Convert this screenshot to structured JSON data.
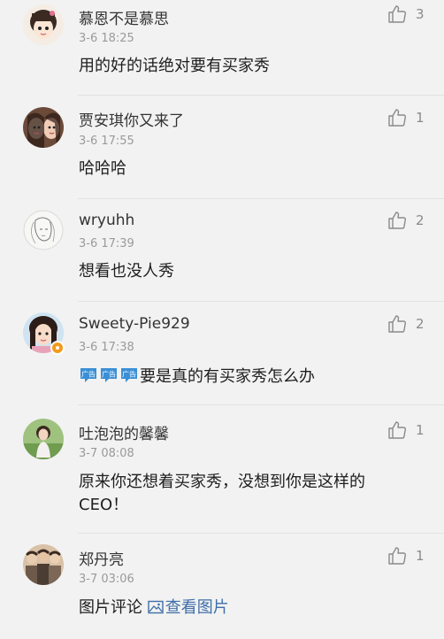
{
  "comments": [
    {
      "name": "慕恩不是慕思",
      "time": "3-6 18:25",
      "text": "用的好的话绝对要有买家秀",
      "likes": "3"
    },
    {
      "name": "贾安琪你又来了",
      "time": "3-6 17:55",
      "text": "哈哈哈",
      "likes": "1"
    },
    {
      "name": "wryuhh",
      "time": "3-6 17:39",
      "text": "想看也没人秀",
      "likes": "2"
    },
    {
      "name": "Sweety-Pie929",
      "time": "3-6 17:38",
      "text": "要是真的有买家秀怎么办",
      "likes": "2",
      "emoji_label": "广告"
    },
    {
      "name": "吐泡泡的馨馨",
      "time": "3-7 08:08",
      "text_line1": "原来你还想着买家秀，没想到你是这样的",
      "text_line2": "CEO！",
      "likes": "1"
    },
    {
      "name": "郑丹亮",
      "time": "3-7 03:06",
      "text": "图片评论",
      "link": "查看图片",
      "likes": "1"
    }
  ],
  "colors": {
    "background": "#f2f2f2",
    "name": "#333333",
    "time": "#9a9a9a",
    "link": "#3f6ea8",
    "badge": "#f39a1d",
    "emoji_blue": "#3a8fd6"
  },
  "icons": {
    "like": "thumbs-up-icon",
    "image": "image-icon"
  }
}
